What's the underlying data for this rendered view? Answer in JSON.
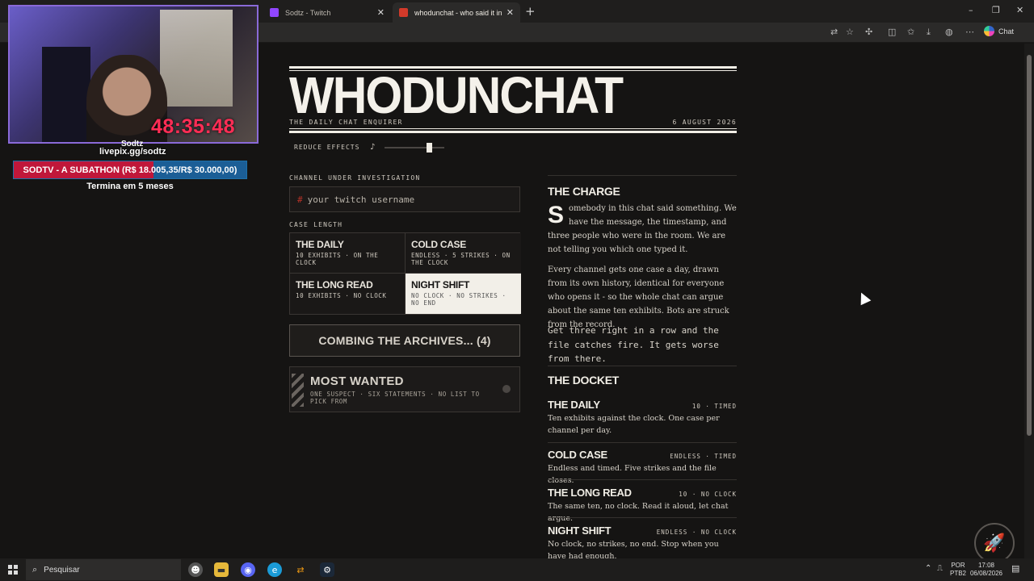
{
  "browser": {
    "tabs": [
      {
        "title": "Sodtz - Twitch",
        "favicon_color": "#9146ff",
        "active": false
      },
      {
        "title": "whodunchat - who said it in your c",
        "favicon_color": "#d23a2a",
        "active": true
      }
    ],
    "new_tab": "+",
    "window_controls": [
      "–",
      "❐",
      "✕"
    ],
    "toolbar_icons": [
      "translate-icon",
      "favorite-star-icon",
      "extensions-icon",
      "split-screen-icon",
      "favorites-icon",
      "download-icon",
      "profile-icon",
      "more-icon"
    ],
    "chat_label": "Chat"
  },
  "overlay": {
    "timer": "48:35:48",
    "handle": "Sodtz",
    "link": "livepix.gg/sodtz",
    "goal": "SODTV - A SUBATHON (R$ 18.005,35/R$ 30.000,00)",
    "goal_progress": 0.6,
    "goal_sub": "Termina em 5 meses"
  },
  "page": {
    "masthead": "WHODUNCHAT",
    "tagline": "THE DAILY CHAT ENQUIRER",
    "date": "6 AUGUST 2026",
    "reduce_effects": "REDUCE EFFECTS",
    "note_icon": "♪",
    "effects_level": 0.75,
    "channel_label": "CHANNEL UNDER INVESTIGATION",
    "username_prefix": "#",
    "username_placeholder": "your twitch username",
    "case_length_label": "CASE LENGTH",
    "modes": [
      {
        "title": "THE DAILY",
        "sub": "10 EXHIBITS · ON THE CLOCK",
        "selected": false
      },
      {
        "title": "COLD CASE",
        "sub": "ENDLESS · 5 STRIKES · ON THE CLOCK",
        "selected": false
      },
      {
        "title": "THE LONG READ",
        "sub": "10 EXHIBITS · NO CLOCK",
        "selected": false
      },
      {
        "title": "NIGHT SHIFT",
        "sub": "NO CLOCK · NO STRIKES · NO END",
        "selected": true
      }
    ],
    "start_button": "COMBING THE ARCHIVES... (4)",
    "most_wanted": {
      "title": "MOST WANTED",
      "sub": "ONE SUSPECT · SIX STATEMENTS · NO LIST TO PICK FROM"
    },
    "charge": {
      "heading": "THE CHARGE",
      "dropcap": "S",
      "p1": "omebody in this chat said something. We have the message, the timestamp, and three people who were in the room. We are not telling you which one typed it.",
      "p2": "Every channel gets one case a day, drawn from its own history, identical for everyone who opens it - so the whole chat can argue about the same ten exhibits. Bots are struck from the record.",
      "p3": "Get three right in a row and the file catches fire. It gets worse from there."
    },
    "docket": {
      "heading": "THE DOCKET",
      "items": [
        {
          "name": "THE DAILY",
          "meta": "10 · TIMED",
          "desc": "Ten exhibits against the clock. One case per channel per day."
        },
        {
          "name": "COLD CASE",
          "meta": "ENDLESS · TIMED",
          "desc": "Endless and timed. Five strikes and the file closes."
        },
        {
          "name": "THE LONG READ",
          "meta": "10 · NO CLOCK",
          "desc": "The same ten, no clock. Read it aloud, let chat argue."
        },
        {
          "name": "NIGHT SHIFT",
          "meta": "ENDLESS · NO CLOCK",
          "desc": "No clock, no strikes, no end. Stop when you have had enough."
        }
      ]
    }
  },
  "taskbar": {
    "search_placeholder": "Pesquisar",
    "lang_top": "POR",
    "lang_bottom": "PTB2",
    "time": "17:08",
    "date": "06/08/2026"
  }
}
